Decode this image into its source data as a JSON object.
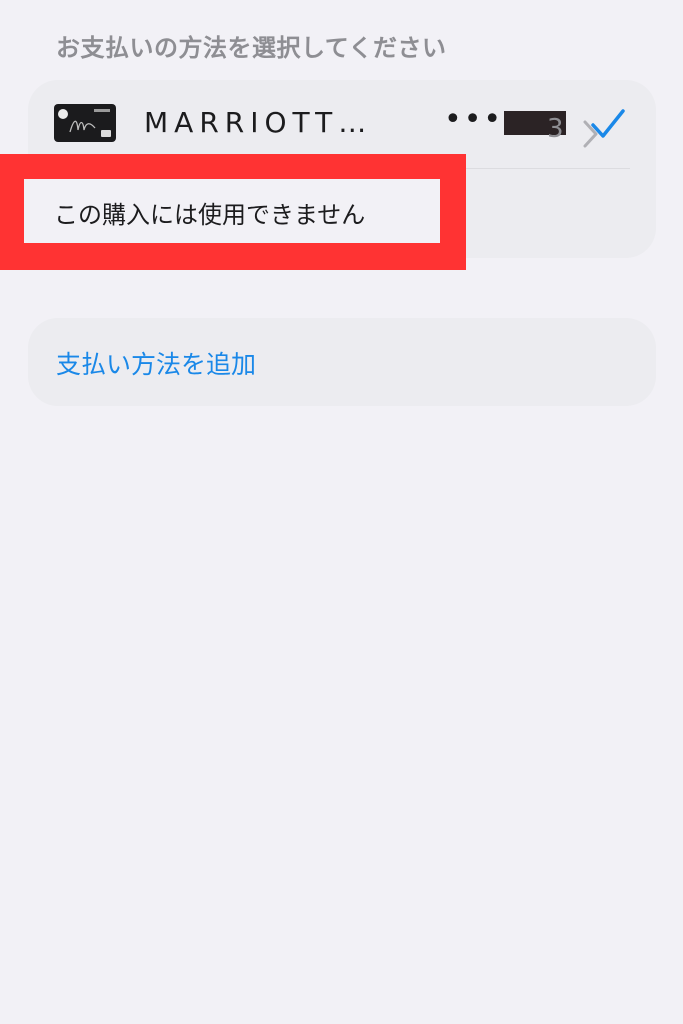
{
  "section": {
    "title": "お支払いの方法を選択してください"
  },
  "payment": {
    "card_name": "MARRIOTT…",
    "masked_number": "••••",
    "count": "3",
    "unavailable_message": "この購入には使用できません"
  },
  "add_payment": {
    "label": "支払い方法を追加"
  },
  "icons": {
    "check": "checkmark-icon",
    "chevron": "chevron-right-icon",
    "card": "credit-card-icon"
  },
  "colors": {
    "accent": "#1a88e8",
    "highlight": "#ff3333",
    "background": "#f2f1f6",
    "card_background": "#ececf0"
  }
}
